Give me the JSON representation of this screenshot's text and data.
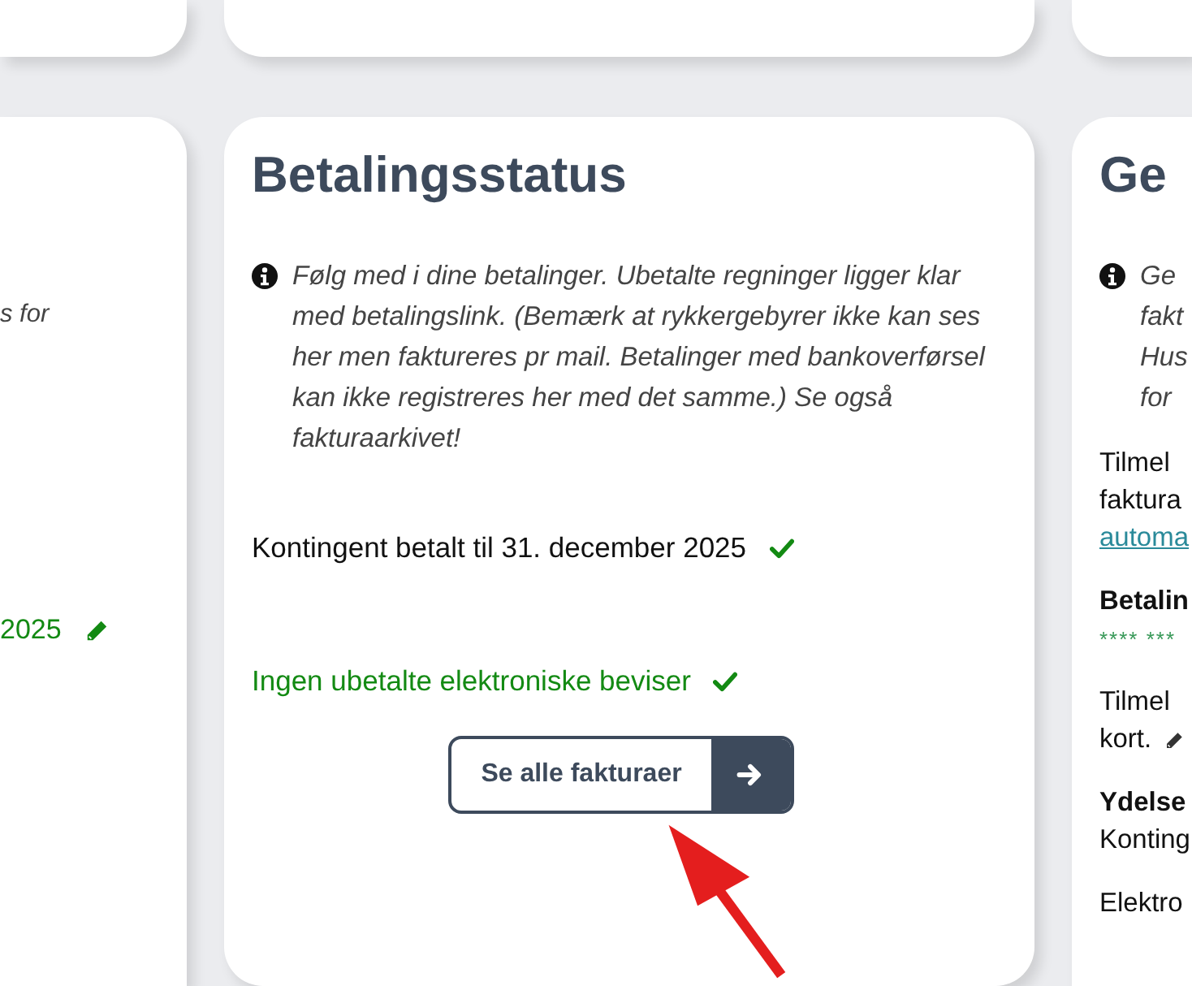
{
  "left_card": {
    "info_fragment": "s for",
    "status_text": "2025",
    "status_editable": true
  },
  "middle_card": {
    "title": "Betalingsstatus",
    "info": "Følg med i dine betalinger. Ubetalte regninger ligger klar med betalingslink. (Bemærk at rykkergebyrer ikke kan ses her men faktureres pr mail. Betalinger med bankoverførsel kan ikke registreres her med det samme.) Se også fakturaarkivet!",
    "membership": {
      "text": "Kontingent betalt til 31. december 2025",
      "ok": true
    },
    "invoices": {
      "text": "Ingen ubetalte elektroniske beviser",
      "ok": true
    },
    "button": "Se alle fakturaer"
  },
  "right_card": {
    "title": "Ge",
    "info_lines": [
      "Ge",
      "fakt",
      "Hus",
      "for"
    ],
    "groups": [
      [
        {
          "kind": "text",
          "text": "Tilmel"
        },
        {
          "kind": "text",
          "text": "faktura"
        },
        {
          "kind": "link",
          "text": "automa"
        }
      ],
      [
        {
          "kind": "heading",
          "text": "Betalin"
        },
        {
          "kind": "masked",
          "text": "**** ***"
        }
      ],
      [
        {
          "kind": "text",
          "text": "Tilmel"
        },
        {
          "kind": "text",
          "text": "kort.",
          "editable": true
        }
      ],
      [
        {
          "kind": "heading",
          "text": "Ydelse"
        },
        {
          "kind": "text",
          "text": "Konting"
        }
      ],
      [
        {
          "kind": "text",
          "text": "Elektro"
        }
      ]
    ]
  }
}
